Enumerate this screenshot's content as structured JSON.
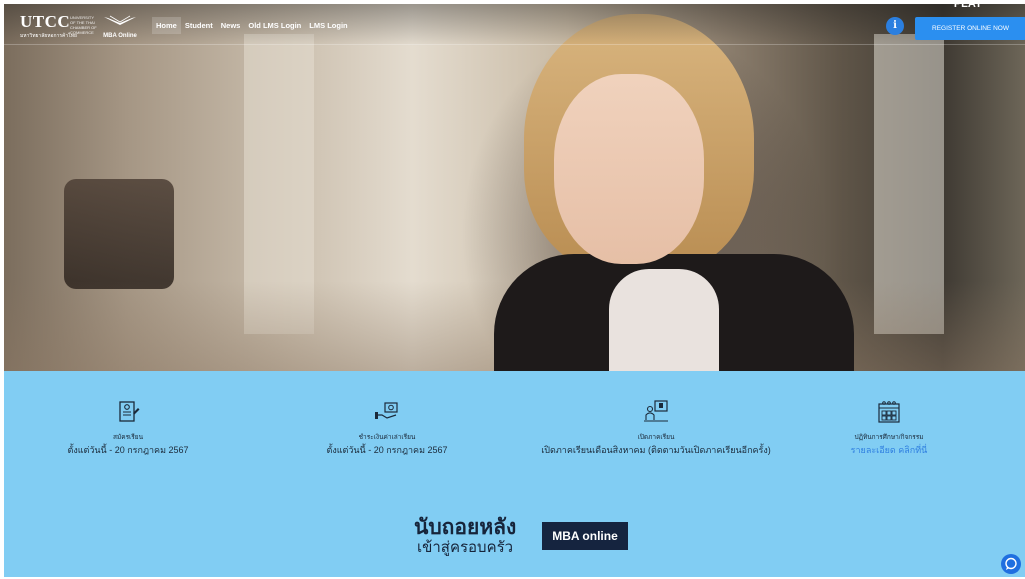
{
  "header": {
    "logo_utcc": "UTCC",
    "logo_utcc_en": "UNIVERSITY OF THE THAI CHAMBER OF COMMERCE",
    "logo_utcc_th": "มหาวิทยาลัยหอการค้าไทย",
    "logo_mba": "MBA Online",
    "nav": [
      "Home",
      "Student",
      "News",
      "Old LMS Login",
      "LMS Login"
    ],
    "active_nav": "Home",
    "info_icon_glyph": "i",
    "register_label": "REGISTER ONLINE NOW",
    "play_badge": "PLAY"
  },
  "info": {
    "items": [
      {
        "icon": "application-form-icon",
        "label": "สมัครเรียน",
        "value": "ตั้งแต่วันนี้ - 20 กรกฎาคม 2567"
      },
      {
        "icon": "payment-icon",
        "label": "ชำระเงินค่าเล่าเรียน",
        "value": "ตั้งแต่วันนี้ - 20 กรกฎาคม 2567"
      },
      {
        "icon": "class-start-icon",
        "label": "เปิดภาคเรียน",
        "value": "เปิดภาคเรียนเดือนสิงหาคม (ติดตามวันเปิดภาคเรียนอีกครั้ง)"
      },
      {
        "icon": "calendar-icon",
        "label": "ปฏิทินการศึกษา/กิจกรรม",
        "link": "รายละเอียด คลิกที่นี่"
      }
    ]
  },
  "promo": {
    "line1": "นับถอยหลัง",
    "line2": "เข้าสู่ครอบครัว",
    "badge": "MBA online"
  },
  "colors": {
    "info_bg": "#81cdf3",
    "accent": "#2b8ff0",
    "navy": "#15243f"
  }
}
